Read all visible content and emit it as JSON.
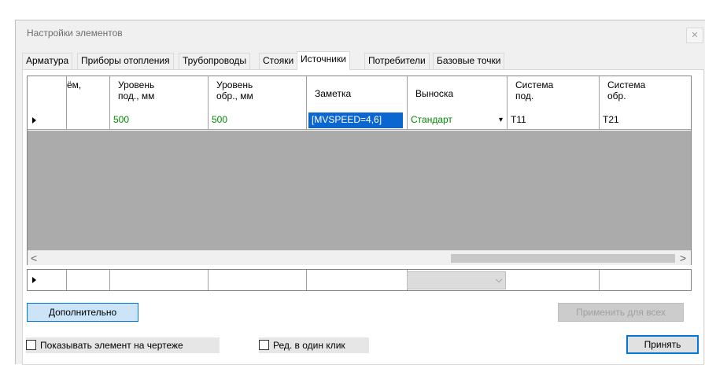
{
  "window": {
    "title": "Настройки элементов",
    "close_glyph": "✕"
  },
  "tabs": [
    {
      "label": "Арматура"
    },
    {
      "label": "Приборы отопления"
    },
    {
      "label": "Трубопроводы"
    },
    {
      "label": "Стояки"
    },
    {
      "label": "Источники",
      "active": true
    },
    {
      "label": "Потребители"
    },
    {
      "label": "Базовые точки"
    }
  ],
  "grid": {
    "columns": [
      "ём,",
      "Уровень\nпод., мм",
      "Уровень\nобр., мм",
      "Заметка",
      "Выноска",
      "Система\nпод.",
      "Система\nобр."
    ],
    "row": {
      "level_sup": "500",
      "level_ret": "500",
      "note": "[MVSPEED=4,6]",
      "callout": "Стандарт",
      "system_sup": "T11",
      "system_ret": "T21"
    },
    "scroll_left": "<",
    "scroll_right": ">",
    "dropdown_glyph": "▾",
    "new_row_dropdown_glyph": "⌵"
  },
  "buttons": {
    "advanced": "Дополнительно",
    "apply_all": "Применить для всех",
    "accept": "Принять"
  },
  "checkboxes": {
    "show_on_drawing": "Показывать элемент на чертеже",
    "single_click_edit": "Ред. в один клик"
  },
  "colors": {
    "selection": "#0b67cf",
    "value_text": "#008a00",
    "accent": "#0078d7"
  }
}
